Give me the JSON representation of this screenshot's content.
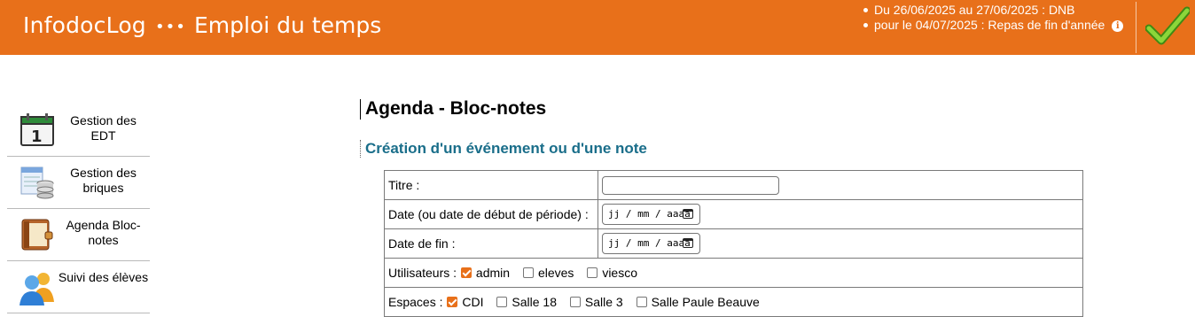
{
  "header": {
    "brand": "InfodocLog",
    "menu_dots": "•••",
    "page_title": "Emploi du temps",
    "notices": [
      "Du 26/06/2025 au 27/06/2025 : DNB",
      "pour le 04/07/2025 : Repas de fin d'année"
    ],
    "info_glyph": "i",
    "accent_color": "#e8701a"
  },
  "sidebar": {
    "items": [
      {
        "label": "Gestion des EDT",
        "icon": "calendar-icon"
      },
      {
        "label": "Gestion des briques",
        "icon": "database-icon"
      },
      {
        "label": "Agenda Bloc-notes",
        "icon": "notebook-icon"
      },
      {
        "label": "Suivi des élèves",
        "icon": "users-icon"
      }
    ]
  },
  "main": {
    "title": "Agenda - Bloc-notes",
    "subtitle": "Création d'un événement ou d'une note",
    "form": {
      "title_label": "Titre :",
      "title_value": "",
      "start_label": "Date (ou date de début de période) :",
      "start_placeholder": "jj / mm / aaaa",
      "end_label": "Date de fin :",
      "end_placeholder": "jj / mm / aaaa",
      "users_label": "Utilisateurs :",
      "users": [
        {
          "label": "admin",
          "checked": true
        },
        {
          "label": "eleves",
          "checked": false
        },
        {
          "label": "viesco",
          "checked": false
        }
      ],
      "spaces_label": "Espaces :",
      "spaces": [
        {
          "label": "CDI",
          "checked": true
        },
        {
          "label": "Salle 18",
          "checked": false
        },
        {
          "label": "Salle 3",
          "checked": false
        },
        {
          "label": "Salle Paule Beauve",
          "checked": false
        }
      ]
    }
  }
}
